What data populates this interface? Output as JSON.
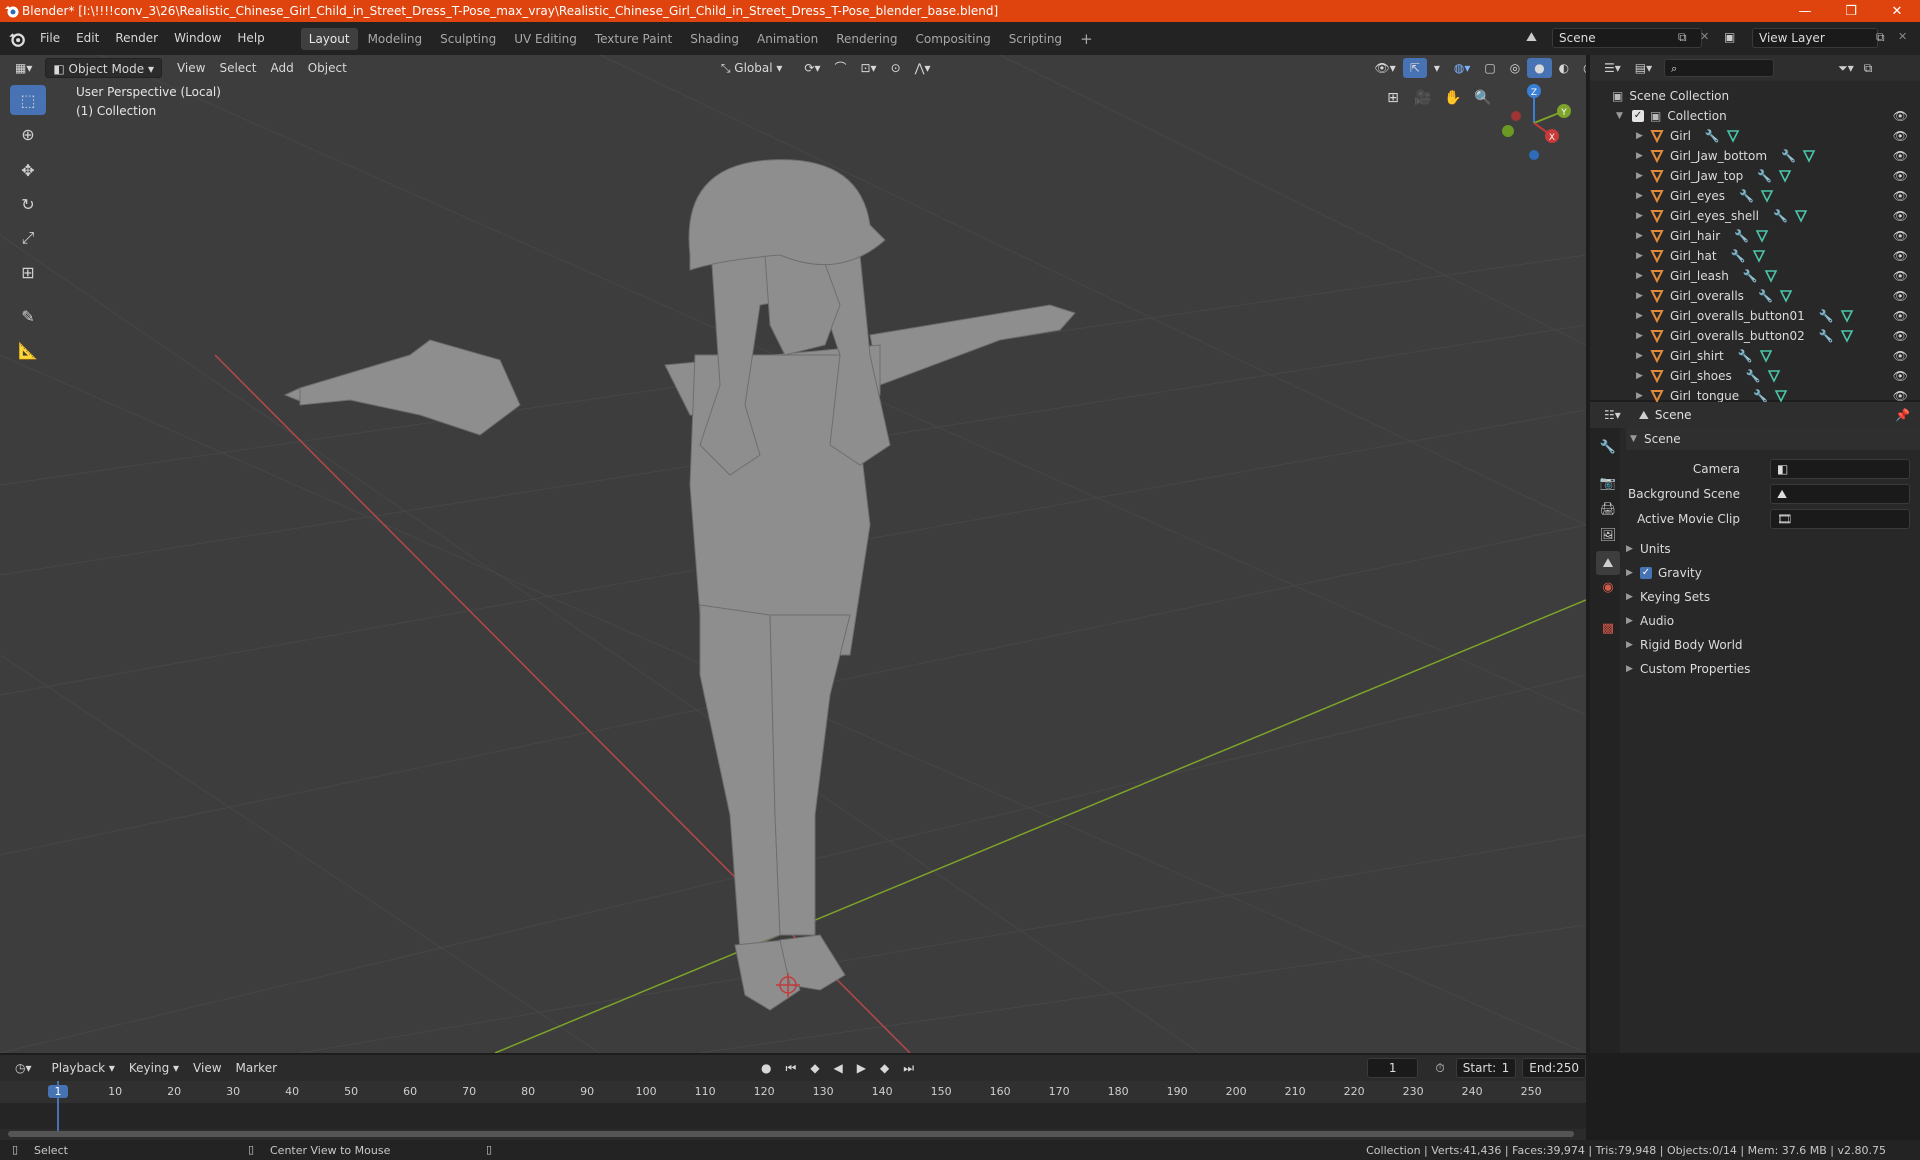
{
  "window": {
    "title": "Blender* [I:\\!!!!conv_3\\26\\Realistic_Chinese_Girl_Child_in_Street_Dress_T-Pose_max_vray\\Realistic_Chinese_Girl_Child_in_Street_Dress_T-Pose_blender_base.blend]",
    "minimize": "—",
    "maximize": "❐",
    "close": "✕"
  },
  "menu": [
    "File",
    "Edit",
    "Render",
    "Window",
    "Help"
  ],
  "workspaces": [
    "Layout",
    "Modeling",
    "Sculpting",
    "UV Editing",
    "Texture Paint",
    "Shading",
    "Animation",
    "Rendering",
    "Compositing",
    "Scripting"
  ],
  "workspace_add": "+",
  "scene_field": "Scene",
  "view_layer_field": "View Layer",
  "viewport": {
    "mode": "Object Mode",
    "menus": [
      "View",
      "Select",
      "Add",
      "Object"
    ],
    "transform_orientation": "Global",
    "perspective_label": "User Perspective (Local)",
    "collection_label": "(1) Collection",
    "gizmo": {
      "x": "X",
      "y": "Y",
      "z": "Z"
    }
  },
  "outliner": {
    "root": "Scene Collection",
    "collection": "Collection",
    "objects": [
      "Girl",
      "Girl_Jaw_bottom",
      "Girl_Jaw_top",
      "Girl_eyes",
      "Girl_eyes_shell",
      "Girl_hair",
      "Girl_hat",
      "Girl_leash",
      "Girl_overalls",
      "Girl_overalls_button01",
      "Girl_overalls_button02",
      "Girl_shirt",
      "Girl_shoes",
      "Girl_tongue"
    ]
  },
  "properties": {
    "header": "Scene",
    "panel": "Scene",
    "camera_label": "Camera",
    "background_scene_label": "Background Scene",
    "active_movie_clip_label": "Active Movie Clip",
    "sections": [
      "Units",
      "Gravity",
      "Keying Sets",
      "Audio",
      "Rigid Body World",
      "Custom Properties"
    ],
    "gravity_checked": true
  },
  "timeline": {
    "menus": [
      "Playback",
      "Keying",
      "View",
      "Marker"
    ],
    "current_frame": "1",
    "start_label": "Start:",
    "start": "1",
    "end_label": "End:",
    "end": "250",
    "ruler": [
      "1",
      "10",
      "20",
      "30",
      "40",
      "50",
      "60",
      "70",
      "80",
      "90",
      "100",
      "110",
      "120",
      "130",
      "140",
      "150",
      "160",
      "170",
      "180",
      "190",
      "200",
      "210",
      "220",
      "230",
      "240",
      "250"
    ]
  },
  "status": {
    "left_action": "Select",
    "middle_action": "Center View to Mouse",
    "stats": "Collection | Verts:41,436 | Faces:39,974 | Tris:79,948 | Objects:0/14 | Mem: 37.6 MB | v2.80.75"
  },
  "colors": {
    "accent": "#4772b3",
    "titlebar": "#e0440e",
    "x_axis": "#c83a3a",
    "y_axis": "#7ea32a",
    "z_axis": "#3a7fd6"
  }
}
